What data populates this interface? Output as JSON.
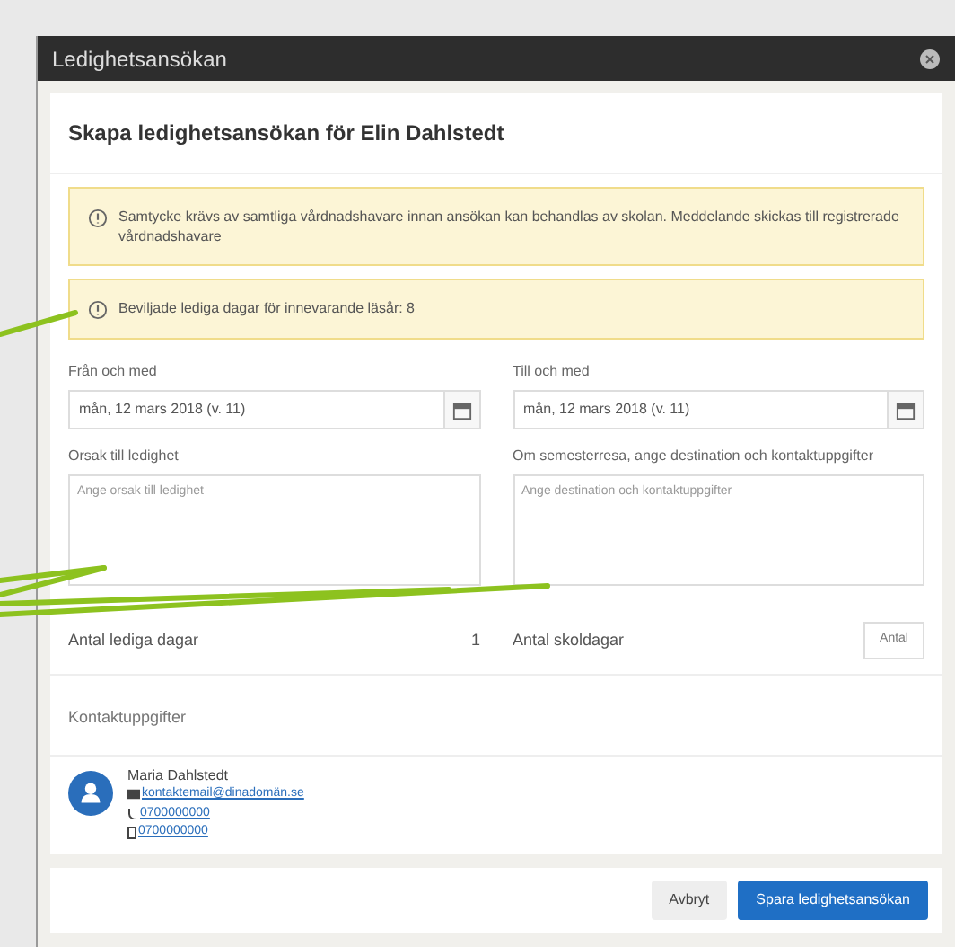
{
  "window": {
    "title": "Ledighetsansökan"
  },
  "heading": "Skapa ledighetsansökan för Elin Dahlstedt",
  "alerts": [
    "Samtycke krävs av samtliga vårdnadshavare innan ansökan kan behandlas av skolan. Meddelande skickas till registrerade vårdnadshavare",
    "Beviljade lediga dagar för innevarande läsår: 8"
  ],
  "dates": [
    {
      "label": "Från och med",
      "value": "mån, 12 mars 2018 (v. 11)"
    },
    {
      "label": "Till och med",
      "value": "mån, 12 mars 2018 (v. 11)"
    }
  ],
  "texts": [
    {
      "label": "Orsak till ledighet",
      "placeholder": "Ange orsak till ledighet"
    },
    {
      "label": "Om semesterresa, ange destination och kontaktuppgifter",
      "placeholder": "Ange destination och kontaktuppgifter"
    }
  ],
  "counts": {
    "days_label": "Antal lediga dagar",
    "days_value": "1",
    "school_days_label": "Antal skoldagar",
    "school_days_button": "Antal"
  },
  "contacts": {
    "title": "Kontaktuppgifter",
    "name": "Maria Dahlstedt",
    "email": "kontaktemail@dinadomän.se",
    "phone": "0700000000",
    "mobile": "0700000000"
  },
  "buttons": [
    {
      "label": "Avbryt",
      "kind": "secondary"
    },
    {
      "label": "Spara ledighetsansökan",
      "kind": "primary"
    }
  ]
}
